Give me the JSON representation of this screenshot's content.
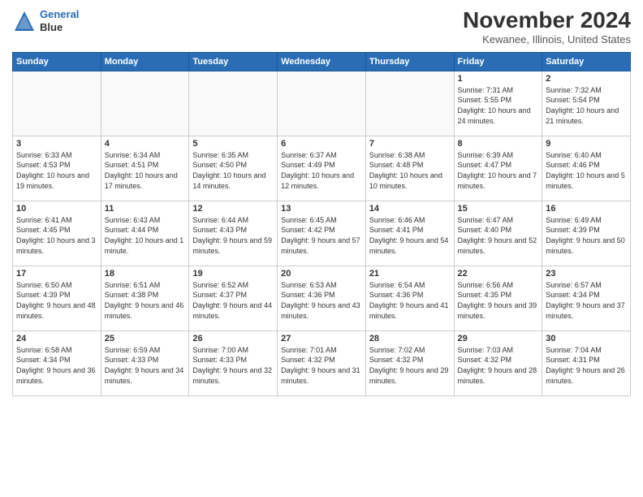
{
  "header": {
    "logo_line1": "General",
    "logo_line2": "Blue",
    "month_title": "November 2024",
    "location": "Kewanee, Illinois, United States"
  },
  "weekdays": [
    "Sunday",
    "Monday",
    "Tuesday",
    "Wednesday",
    "Thursday",
    "Friday",
    "Saturday"
  ],
  "weeks": [
    [
      {
        "day": "",
        "info": ""
      },
      {
        "day": "",
        "info": ""
      },
      {
        "day": "",
        "info": ""
      },
      {
        "day": "",
        "info": ""
      },
      {
        "day": "",
        "info": ""
      },
      {
        "day": "1",
        "info": "Sunrise: 7:31 AM\nSunset: 5:55 PM\nDaylight: 10 hours and 24 minutes."
      },
      {
        "day": "2",
        "info": "Sunrise: 7:32 AM\nSunset: 5:54 PM\nDaylight: 10 hours and 21 minutes."
      }
    ],
    [
      {
        "day": "3",
        "info": "Sunrise: 6:33 AM\nSunset: 4:53 PM\nDaylight: 10 hours and 19 minutes."
      },
      {
        "day": "4",
        "info": "Sunrise: 6:34 AM\nSunset: 4:51 PM\nDaylight: 10 hours and 17 minutes."
      },
      {
        "day": "5",
        "info": "Sunrise: 6:35 AM\nSunset: 4:50 PM\nDaylight: 10 hours and 14 minutes."
      },
      {
        "day": "6",
        "info": "Sunrise: 6:37 AM\nSunset: 4:49 PM\nDaylight: 10 hours and 12 minutes."
      },
      {
        "day": "7",
        "info": "Sunrise: 6:38 AM\nSunset: 4:48 PM\nDaylight: 10 hours and 10 minutes."
      },
      {
        "day": "8",
        "info": "Sunrise: 6:39 AM\nSunset: 4:47 PM\nDaylight: 10 hours and 7 minutes."
      },
      {
        "day": "9",
        "info": "Sunrise: 6:40 AM\nSunset: 4:46 PM\nDaylight: 10 hours and 5 minutes."
      }
    ],
    [
      {
        "day": "10",
        "info": "Sunrise: 6:41 AM\nSunset: 4:45 PM\nDaylight: 10 hours and 3 minutes."
      },
      {
        "day": "11",
        "info": "Sunrise: 6:43 AM\nSunset: 4:44 PM\nDaylight: 10 hours and 1 minute."
      },
      {
        "day": "12",
        "info": "Sunrise: 6:44 AM\nSunset: 4:43 PM\nDaylight: 9 hours and 59 minutes."
      },
      {
        "day": "13",
        "info": "Sunrise: 6:45 AM\nSunset: 4:42 PM\nDaylight: 9 hours and 57 minutes."
      },
      {
        "day": "14",
        "info": "Sunrise: 6:46 AM\nSunset: 4:41 PM\nDaylight: 9 hours and 54 minutes."
      },
      {
        "day": "15",
        "info": "Sunrise: 6:47 AM\nSunset: 4:40 PM\nDaylight: 9 hours and 52 minutes."
      },
      {
        "day": "16",
        "info": "Sunrise: 6:49 AM\nSunset: 4:39 PM\nDaylight: 9 hours and 50 minutes."
      }
    ],
    [
      {
        "day": "17",
        "info": "Sunrise: 6:50 AM\nSunset: 4:39 PM\nDaylight: 9 hours and 48 minutes."
      },
      {
        "day": "18",
        "info": "Sunrise: 6:51 AM\nSunset: 4:38 PM\nDaylight: 9 hours and 46 minutes."
      },
      {
        "day": "19",
        "info": "Sunrise: 6:52 AM\nSunset: 4:37 PM\nDaylight: 9 hours and 44 minutes."
      },
      {
        "day": "20",
        "info": "Sunrise: 6:53 AM\nSunset: 4:36 PM\nDaylight: 9 hours and 43 minutes."
      },
      {
        "day": "21",
        "info": "Sunrise: 6:54 AM\nSunset: 4:36 PM\nDaylight: 9 hours and 41 minutes."
      },
      {
        "day": "22",
        "info": "Sunrise: 6:56 AM\nSunset: 4:35 PM\nDaylight: 9 hours and 39 minutes."
      },
      {
        "day": "23",
        "info": "Sunrise: 6:57 AM\nSunset: 4:34 PM\nDaylight: 9 hours and 37 minutes."
      }
    ],
    [
      {
        "day": "24",
        "info": "Sunrise: 6:58 AM\nSunset: 4:34 PM\nDaylight: 9 hours and 36 minutes."
      },
      {
        "day": "25",
        "info": "Sunrise: 6:59 AM\nSunset: 4:33 PM\nDaylight: 9 hours and 34 minutes."
      },
      {
        "day": "26",
        "info": "Sunrise: 7:00 AM\nSunset: 4:33 PM\nDaylight: 9 hours and 32 minutes."
      },
      {
        "day": "27",
        "info": "Sunrise: 7:01 AM\nSunset: 4:32 PM\nDaylight: 9 hours and 31 minutes."
      },
      {
        "day": "28",
        "info": "Sunrise: 7:02 AM\nSunset: 4:32 PM\nDaylight: 9 hours and 29 minutes."
      },
      {
        "day": "29",
        "info": "Sunrise: 7:03 AM\nSunset: 4:32 PM\nDaylight: 9 hours and 28 minutes."
      },
      {
        "day": "30",
        "info": "Sunrise: 7:04 AM\nSunset: 4:31 PM\nDaylight: 9 hours and 26 minutes."
      }
    ]
  ]
}
